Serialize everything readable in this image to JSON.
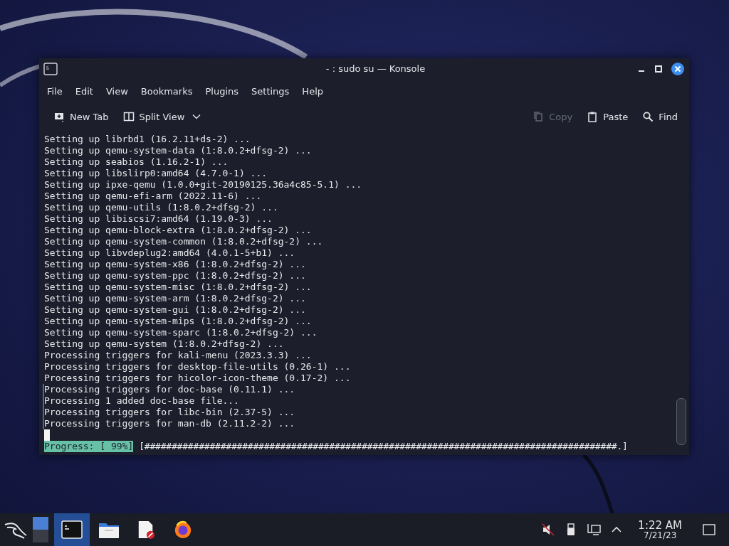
{
  "window": {
    "title": "- : sudo su — Konsole"
  },
  "menu": [
    "File",
    "Edit",
    "View",
    "Bookmarks",
    "Plugins",
    "Settings",
    "Help"
  ],
  "toolbar": [
    {
      "kind": "newtab",
      "label": "New Tab",
      "disabled": false
    },
    {
      "kind": "split",
      "label": "Split View",
      "disabled": false
    },
    {
      "kind": "copy",
      "label": "Copy",
      "disabled": true
    },
    {
      "kind": "paste",
      "label": "Paste",
      "disabled": false
    },
    {
      "kind": "find",
      "label": "Find",
      "disabled": false
    }
  ],
  "terminal": {
    "lines": [
      {
        "text": "Setting up librbd1 (16.2.11+ds-2) ...",
        "marked": false
      },
      {
        "text": "Setting up qemu-system-data (1:8.0.2+dfsg-2) ...",
        "marked": false
      },
      {
        "text": "Setting up seabios (1.16.2-1) ...",
        "marked": false
      },
      {
        "text": "Setting up libslirp0:amd64 (4.7.0-1) ...",
        "marked": false
      },
      {
        "text": "Setting up ipxe-qemu (1.0.0+git-20190125.36a4c85-5.1) ...",
        "marked": false
      },
      {
        "text": "Setting up qemu-efi-arm (2022.11-6) ...",
        "marked": false
      },
      {
        "text": "Setting up qemu-utils (1:8.0.2+dfsg-2) ...",
        "marked": false
      },
      {
        "text": "Setting up libiscsi7:amd64 (1.19.0-3) ...",
        "marked": false
      },
      {
        "text": "Setting up qemu-block-extra (1:8.0.2+dfsg-2) ...",
        "marked": false
      },
      {
        "text": "Setting up qemu-system-common (1:8.0.2+dfsg-2) ...",
        "marked": false
      },
      {
        "text": "Setting up libvdeplug2:amd64 (4.0.1-5+b1) ...",
        "marked": false
      },
      {
        "text": "Setting up qemu-system-x86 (1:8.0.2+dfsg-2) ...",
        "marked": false
      },
      {
        "text": "Setting up qemu-system-ppc (1:8.0.2+dfsg-2) ...",
        "marked": false
      },
      {
        "text": "Setting up qemu-system-misc (1:8.0.2+dfsg-2) ...",
        "marked": false
      },
      {
        "text": "Setting up qemu-system-arm (1:8.0.2+dfsg-2) ...",
        "marked": false
      },
      {
        "text": "Setting up qemu-system-gui (1:8.0.2+dfsg-2) ...",
        "marked": false
      },
      {
        "text": "Setting up qemu-system-mips (1:8.0.2+dfsg-2) ...",
        "marked": false
      },
      {
        "text": "Setting up qemu-system-sparc (1:8.0.2+dfsg-2) ...",
        "marked": false
      },
      {
        "text": "Setting up qemu-system (1:8.0.2+dfsg-2) ...",
        "marked": false
      },
      {
        "text": "Processing triggers for kali-menu (2023.3.3) ...",
        "marked": false
      },
      {
        "text": "Processing triggers for desktop-file-utils (0.26-1) ...",
        "marked": false
      },
      {
        "text": "Processing triggers for hicolor-icon-theme (0.17-2) ...",
        "marked": false
      },
      {
        "text": "Processing triggers for doc-base (0.11.1) ...",
        "marked": true
      },
      {
        "text": "Processing 1 added doc-base file...",
        "marked": true
      },
      {
        "text": "Processing triggers for libc-bin (2.37-5) ...",
        "marked": true
      },
      {
        "text": "Processing triggers for man-db (2.11.2-2) ...",
        "marked": true
      }
    ],
    "progress_label": "Progress: [ 99%]",
    "progress_bar": "[#######################################################################################.]"
  },
  "taskbar": {
    "pager": [
      {
        "selected": true
      },
      {
        "selected": false
      }
    ],
    "tasks": [
      {
        "kind": "terminal",
        "selected": true
      },
      {
        "kind": "files",
        "selected": false
      },
      {
        "kind": "editor",
        "selected": false
      },
      {
        "kind": "browser",
        "selected": false
      }
    ],
    "time": "1:22 AM",
    "date": "7/21/23"
  }
}
